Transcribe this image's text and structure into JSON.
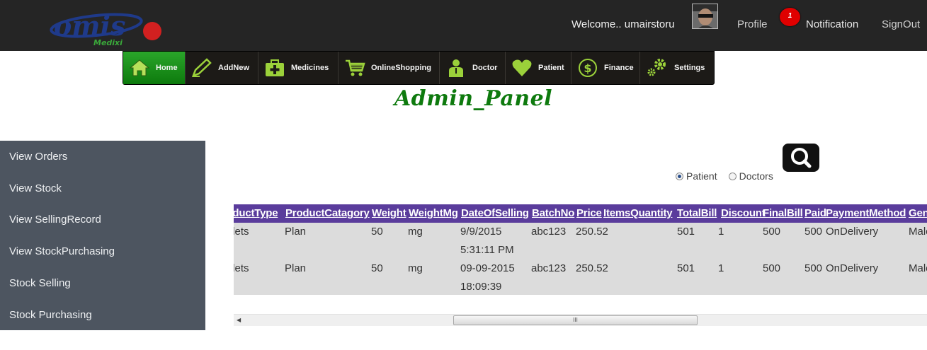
{
  "header": {
    "logo_text": "omis",
    "logo_subtext": "Medixi",
    "welcome": "Welcome.. umairstoru",
    "profile": "Profile",
    "notification_count": "1",
    "notification": "Notification",
    "signout": "SignOut"
  },
  "menu": {
    "items": [
      {
        "label": "Home",
        "icon": "home-icon"
      },
      {
        "label": "AddNew",
        "icon": "pencil-icon"
      },
      {
        "label": "Medicines",
        "icon": "medkit-icon"
      },
      {
        "label": "OnlineShopping",
        "icon": "cart-icon"
      },
      {
        "label": "Doctor",
        "icon": "doctor-icon"
      },
      {
        "label": "Patient",
        "icon": "heart-icon"
      },
      {
        "label": "Finance",
        "icon": "dollar-icon"
      },
      {
        "label": "Settings",
        "icon": "gear-icon"
      }
    ]
  },
  "page_title": "Admin_Panel",
  "sidebar": {
    "items": [
      {
        "label": "View Orders"
      },
      {
        "label": "View Stock"
      },
      {
        "label": "View SellingRecord"
      },
      {
        "label": "View StockPurchasing"
      },
      {
        "label": "Stock Selling"
      },
      {
        "label": "Stock Purchasing"
      }
    ]
  },
  "search": {
    "icon": "search-icon",
    "options": [
      {
        "label": "Patient",
        "checked": true
      },
      {
        "label": "Doctors",
        "checked": false
      }
    ]
  },
  "table": {
    "columns": [
      "ProductType",
      "ProductCatagory",
      "Weight",
      "WeightMg",
      "DateOfSelling",
      "BatchNo",
      "Price",
      "ItemsQuantity",
      "TotalBill",
      "Discount",
      "FinalBill",
      "Paid",
      "PaymentMethod",
      "Gender"
    ],
    "rows": [
      {
        "product_type": "Tablets",
        "category": "Plan",
        "weight": "50",
        "weight_mg": "mg",
        "date_line1": "9/9/2015",
        "date_line2": "5:31:11 PM",
        "batch": "abc123",
        "price": "250.52",
        "total": "501",
        "discount": "1",
        "final": "500",
        "paid": "500",
        "method": "OnDelivery",
        "gender": "Male"
      },
      {
        "product_type": "Tablets",
        "category": "Plan",
        "weight": "50",
        "weight_mg": "mg",
        "date_line1": "09-09-2015",
        "date_line2": "18:09:39",
        "batch": "abc123",
        "price": "250.52",
        "total": "501",
        "discount": "1",
        "final": "500",
        "paid": "500",
        "method": "OnDelivery",
        "gender": "Male"
      }
    ]
  },
  "scrollbar": {
    "grip": "III"
  },
  "colors": {
    "topbar": "#252525",
    "menu_active": "#1a8f1a",
    "title": "#0e7a0e",
    "sidebar": "#4d5560",
    "table_header": "#5a3c9c",
    "table_body": "#dcdcdc",
    "notification_badge": "#e00000"
  }
}
